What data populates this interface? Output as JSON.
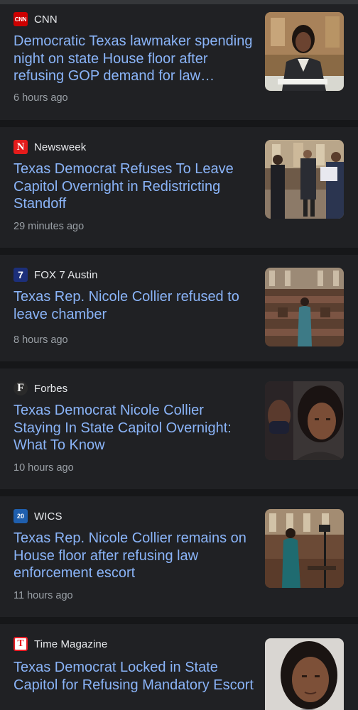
{
  "articles": [
    {
      "source": "CNN",
      "logo_text": "CNN",
      "logo_bg": "#cc0000",
      "logo_fg": "#ffffff",
      "headline": "Democratic Texas lawmaker spending night on state House floor after refusing GOP demand for law…",
      "time": "6 hours ago",
      "thumbnail": "lawmaker-at-desk-photo"
    },
    {
      "source": "Newsweek",
      "logo_text": "N",
      "logo_bg": "#e41b1b",
      "logo_fg": "#ffffff",
      "headline": "Texas Democrat Refuses To Leave Capitol Overnight in Redistricting Standoff",
      "time": "29 minutes ago",
      "thumbnail": "capitol-hallway-group-photo"
    },
    {
      "source": "FOX 7 Austin",
      "logo_text": "7",
      "logo_bg": "#1c2f7a",
      "logo_fg": "#ffffff",
      "headline": "Texas Rep. Nicole Collier refused to leave chamber",
      "time": "8 hours ago",
      "thumbnail": "house-chamber-photo"
    },
    {
      "source": "Forbes",
      "logo_text": "F",
      "logo_bg": "#2a2a2a",
      "logo_fg": "#ffffff",
      "headline": "Texas Democrat Nicole Collier Staying In State Capitol Overnight: What To Know",
      "time": "10 hours ago",
      "thumbnail": "lawmaker-portrait-photo"
    },
    {
      "source": "WICS",
      "logo_text": "20",
      "logo_bg": "#1f5fae",
      "logo_fg": "#ffffff",
      "headline": "Texas Rep. Nicole Collier remains on House floor after refusing law enforcement escort",
      "time": "11 hours ago",
      "thumbnail": "house-floor-camera-photo"
    },
    {
      "source": "Time Magazine",
      "logo_text": "T",
      "logo_bg": "#e81c24",
      "logo_fg": "#ffffff",
      "headline": "Texas Democrat Locked in State Capitol for Refusing Mandatory Escort",
      "time": "",
      "thumbnail": "lawmaker-closeup-photo"
    }
  ]
}
